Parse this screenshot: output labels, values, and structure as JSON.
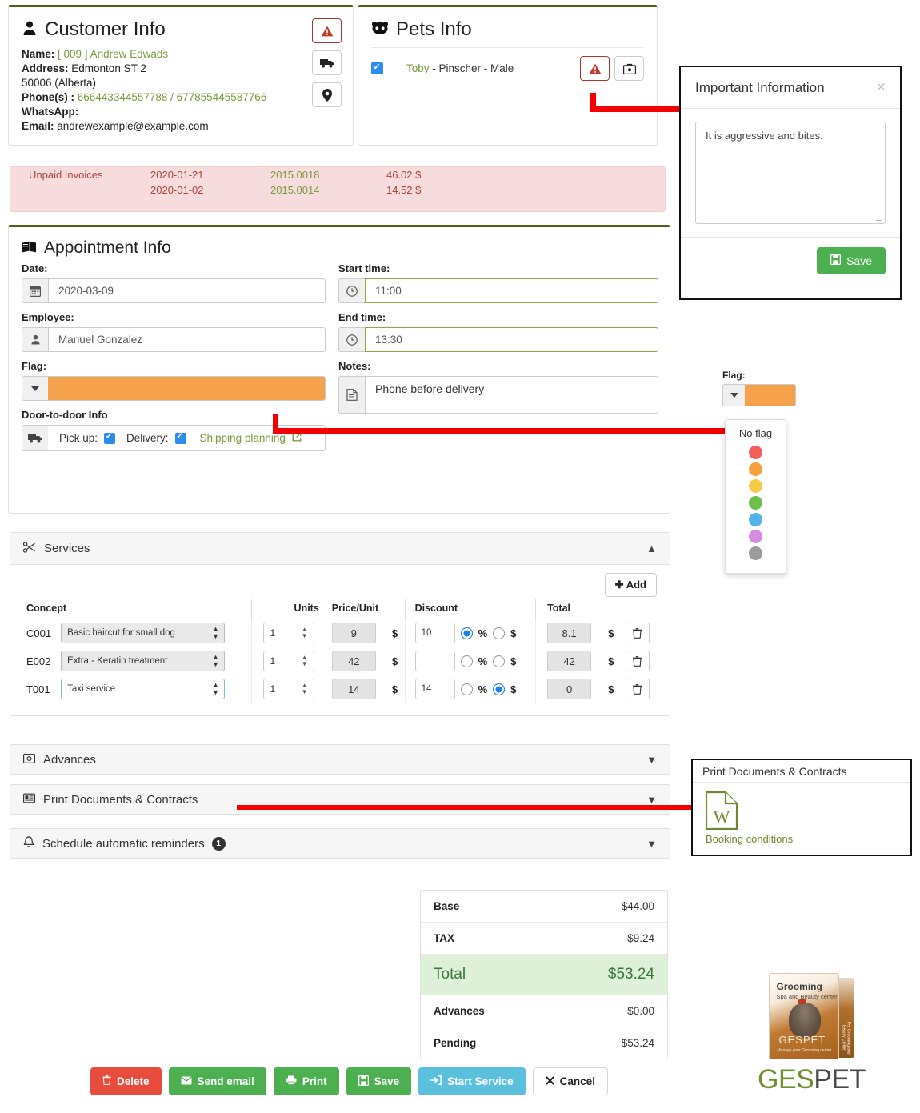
{
  "customer": {
    "title": "Customer Info",
    "icon": "user-icon",
    "name_label": "Name:",
    "name_value": "[ 009 ] Andrew Edwads",
    "address_label": "Address:",
    "address_value": "Edmonton ST 2",
    "postal_line": "50006  (Alberta)",
    "phones_label": "Phone(s) :",
    "phones_value": "666443344557788 / 677855445587766",
    "whatsapp_label": "WhatsApp:",
    "whatsapp_value": "",
    "email_label": "Email:",
    "email_value": "andrewexample@example.com",
    "buttons": [
      {
        "name": "customer-alert-button",
        "glyph": "⚠"
      },
      {
        "name": "customer-truck-button",
        "glyph": "🚚"
      },
      {
        "name": "customer-location-button",
        "glyph": "📍"
      }
    ]
  },
  "pets": {
    "title": "Pets Info",
    "icon": "pet-face-icon",
    "row": {
      "checked": true,
      "name": "Toby",
      "details": " - Pinscher - Male",
      "alert_glyph": "⚠",
      "health_glyph": "💼"
    }
  },
  "unpaid": {
    "label": "Unpaid Invoices",
    "rows": [
      {
        "date": "2020-01-21",
        "number": "2015.0018",
        "amount": "46.02 $"
      },
      {
        "date": "2020-01-02",
        "number": "2015.0014",
        "amount": "14.52 $"
      }
    ]
  },
  "appointment": {
    "title": "Appointment Info",
    "icon": "book-icon",
    "date_label": "Date:",
    "date_value": "2020-03-09",
    "employee_label": "Employee:",
    "employee_value": "Manuel Gonzalez",
    "flag_label": "Flag:",
    "flag_color": "#f5a04b",
    "start_label": "Start time:",
    "start_value": "11:00",
    "end_label": "End time:",
    "end_value": "13:30",
    "notes_label": "Notes:",
    "notes_value": "Phone before delivery",
    "door_label": "Door-to-door Info",
    "pickup_label": "Pick up:",
    "pickup_checked": true,
    "delivery_label": "Delivery:",
    "delivery_checked": true,
    "shipping_link": "Shipping planning"
  },
  "services": {
    "title": "Services",
    "icon": "scissors-icon",
    "caret": "▲",
    "add_label": "Add",
    "headers": {
      "concept": "Concept",
      "units": "Units",
      "price": "Price/Unit",
      "discount": "Discount",
      "total": "Total"
    },
    "rows": [
      {
        "code": "C001",
        "concept": "Basic haircut for small dog",
        "active": false,
        "units": "1",
        "price": "9",
        "price_currency": "$",
        "discount": "10",
        "pct_selected": true,
        "amt_selected": false,
        "pct_symbol": "%",
        "amt_symbol": "$",
        "total": "8.1",
        "total_currency": "$"
      },
      {
        "code": "E002",
        "concept": "Extra - Keratin treatment",
        "active": false,
        "units": "1",
        "price": "42",
        "price_currency": "$",
        "discount": "",
        "pct_selected": false,
        "amt_selected": false,
        "pct_symbol": "%",
        "amt_symbol": "$",
        "total": "42",
        "total_currency": "$"
      },
      {
        "code": "T001",
        "concept": "Taxi service",
        "active": true,
        "units": "1",
        "price": "14",
        "price_currency": "$",
        "discount": "14",
        "pct_selected": false,
        "amt_selected": true,
        "pct_symbol": "%",
        "amt_symbol": "$",
        "total": "0",
        "total_currency": "$"
      }
    ]
  },
  "accordions": [
    {
      "name": "advances",
      "label": "Advances",
      "icon": "money-icon",
      "caret": "▼",
      "badge": null
    },
    {
      "name": "print-documents",
      "label": "Print Documents & Contracts",
      "icon": "documents-icon",
      "caret": "▼",
      "badge": null
    },
    {
      "name": "schedule-reminders",
      "label": "Schedule automatic reminders",
      "icon": "bell-icon",
      "caret": "▼",
      "badge": "1"
    }
  ],
  "important_info_modal": {
    "title": "Important Information",
    "close_glyph": "×",
    "text": "It is aggressive and bites.",
    "save_label": "Save",
    "save_icon": "floppy-icon"
  },
  "flag_dropdown": {
    "label": "Flag:",
    "selected_color": "#f5a04b",
    "no_flag_label": "No flag",
    "colors": [
      "#f4615d",
      "#f5a23c",
      "#f6ca45",
      "#6cc04a",
      "#4fb3e8",
      "#d78ce0",
      "#9b9b9b"
    ]
  },
  "print_callout": {
    "title": "Print Documents & Contracts",
    "doc_icon": "word-document-icon",
    "doc_letter": "W",
    "doc_label": "Booking conditions"
  },
  "totals": {
    "rows": [
      {
        "label": "Base",
        "value": "$44.00",
        "highlight": false
      },
      {
        "label": "TAX",
        "value": "$9.24",
        "highlight": false
      },
      {
        "label": "Total",
        "value": "$53.24",
        "highlight": true
      },
      {
        "label": "Advances",
        "value": "$0.00",
        "highlight": false
      },
      {
        "label": "Pending",
        "value": "$53.24",
        "highlight": false
      }
    ]
  },
  "actions": [
    {
      "name": "delete-button",
      "label": "Delete",
      "icon": "trash-icon",
      "glyph": "🗑",
      "style": "del"
    },
    {
      "name": "send-email-button",
      "label": "Send email",
      "icon": "envelope-icon",
      "glyph": "✉",
      "style": "grn"
    },
    {
      "name": "print-button",
      "label": "Print",
      "icon": "printer-icon",
      "glyph": "⎙",
      "style": "grn"
    },
    {
      "name": "save-button",
      "label": "Save",
      "icon": "floppy-icon",
      "glyph": "💾",
      "style": "grn"
    },
    {
      "name": "start-service-button",
      "label": "Start Service",
      "icon": "login-arrow-icon",
      "glyph": "↦",
      "style": "blu"
    },
    {
      "name": "cancel-button",
      "label": "Cancel",
      "icon": "close-x-icon",
      "glyph": "✖",
      "style": "wht"
    }
  ],
  "logo": {
    "box_title": "Grooming",
    "box_subtitle": "Spa and Beauty center",
    "box_brand": "GESPET",
    "box_tagline": "Manage your Grooming center",
    "spine_text": "Pet Grooming and Beauty Center",
    "text_ges": "GES",
    "text_pet": "PET"
  }
}
